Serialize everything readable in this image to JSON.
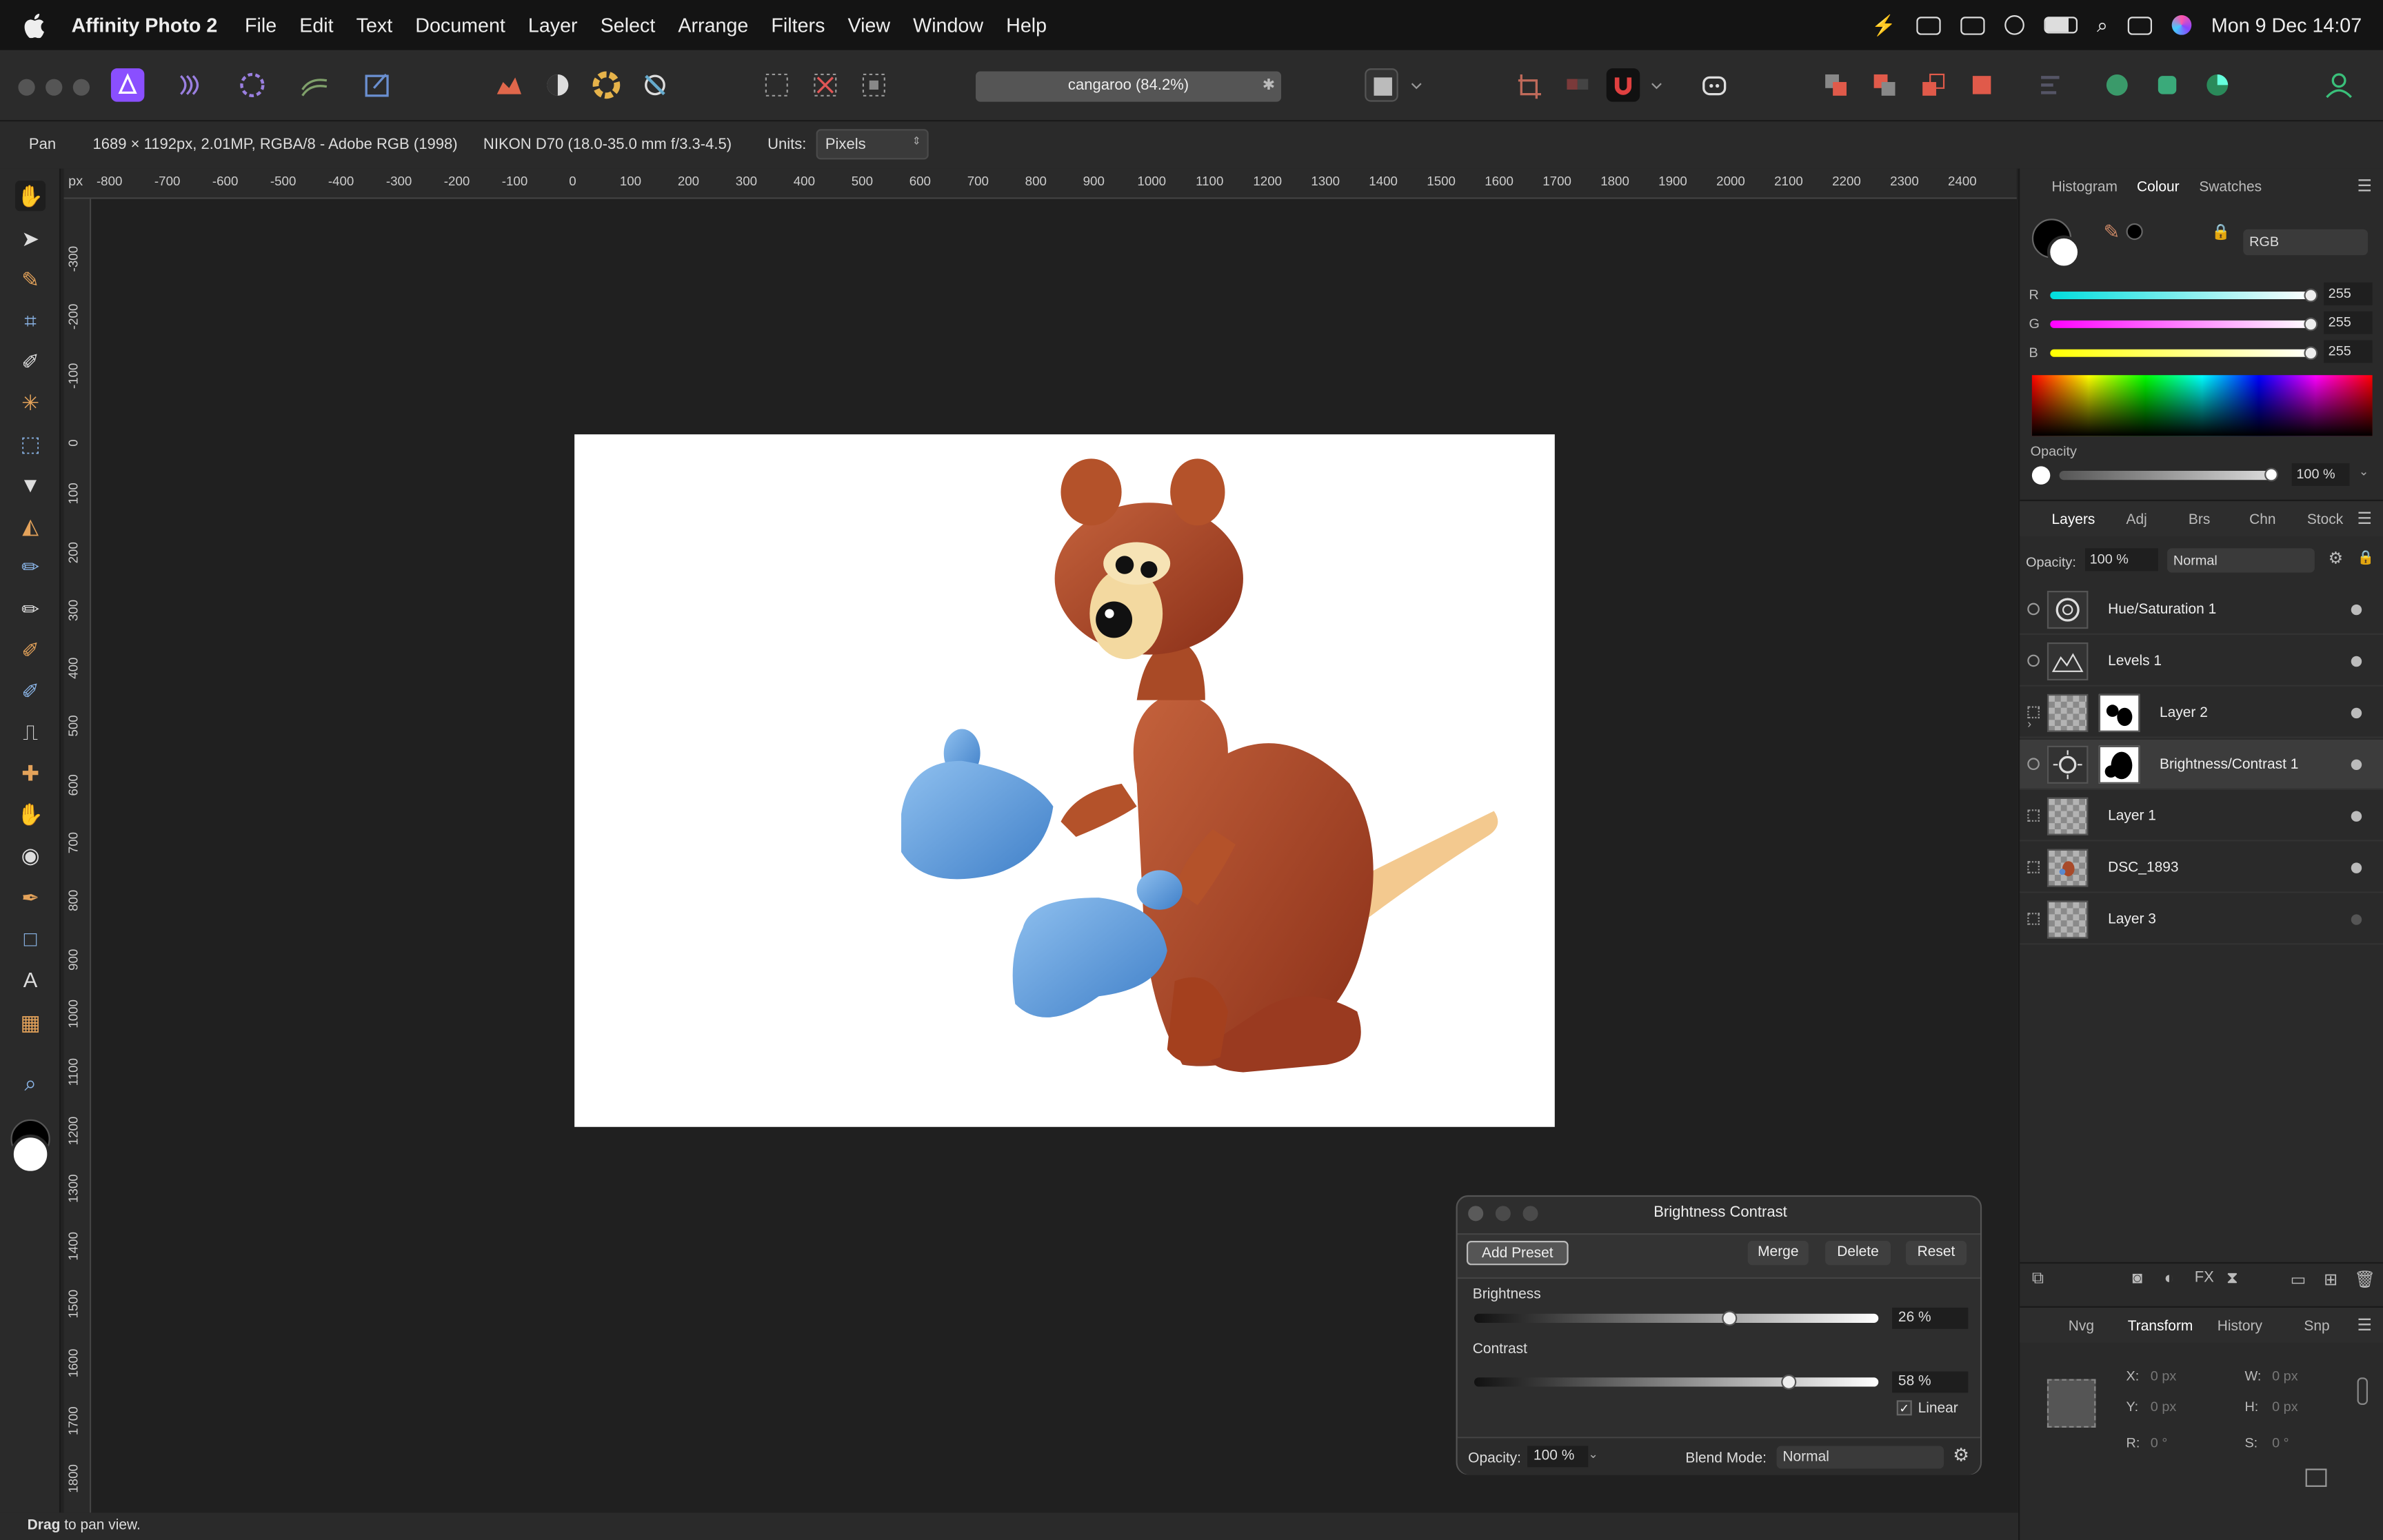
{
  "menubar": {
    "app": "Affinity Photo 2",
    "items": [
      "File",
      "Edit",
      "Text",
      "Document",
      "Layer",
      "Select",
      "Arrange",
      "Filters",
      "View",
      "Window",
      "Help"
    ],
    "clock": "Mon 9 Dec  14:07"
  },
  "toolbar": {
    "document_title": "cangaroo (84.2%)"
  },
  "context": {
    "tool": "Pan",
    "doc_info": "1689 × 1192px, 2.01MP, RGBA/8 - Adobe RGB (1998)",
    "camera": "NIKON D70 (18.0-35.0 mm f/3.3-4.5)",
    "units_label": "Units:",
    "units_value": "Pixels"
  },
  "ruler": {
    "unit": "px",
    "h_ticks": [
      "-800",
      "-700",
      "-600",
      "-500",
      "-400",
      "-300",
      "-200",
      "-100",
      "0",
      "100",
      "200",
      "300",
      "400",
      "500",
      "600",
      "700",
      "800",
      "900",
      "1000",
      "1100",
      "1200",
      "1300",
      "1400",
      "1500",
      "1600",
      "1700",
      "1800",
      "1900",
      "2000",
      "2100",
      "2200",
      "2300",
      "2400"
    ],
    "v_ticks": [
      "-300",
      "-200",
      "-100",
      "0",
      "100",
      "200",
      "300",
      "400",
      "500",
      "600",
      "700",
      "800",
      "900",
      "1000",
      "1100",
      "1200",
      "1300",
      "1400",
      "1500",
      "1600",
      "1700",
      "1800"
    ]
  },
  "colour_panel": {
    "tabs": [
      "Histogram",
      "Colour",
      "Swatches"
    ],
    "active_tab": "Colour",
    "model": "RGB",
    "r_label": "R",
    "g_label": "G",
    "b_label": "B",
    "r": "255",
    "g": "255",
    "b": "255",
    "opacity_label": "Opacity",
    "opacity": "100 %"
  },
  "layers_panel": {
    "tabs": [
      "Layers",
      "Adj",
      "Brs",
      "Chn",
      "Stock"
    ],
    "active_tab": "Layers",
    "opacity_label": "Opacity:",
    "opacity": "100 %",
    "blend": "Normal",
    "layers": [
      {
        "name": "Hue/Saturation 1"
      },
      {
        "name": "Levels 1"
      },
      {
        "name": "Layer 2"
      },
      {
        "name": "Brightness/Contrast 1"
      },
      {
        "name": "Layer 1"
      },
      {
        "name": "DSC_1893"
      },
      {
        "name": "Layer 3"
      }
    ]
  },
  "transform_panel": {
    "tabs": [
      "Nvg",
      "Transform",
      "History",
      "Snp"
    ],
    "active_tab": "Transform",
    "x_label": "X:",
    "x": "0 px",
    "y_label": "Y:",
    "y": "0 px",
    "w_label": "W:",
    "w": "0 px",
    "h_label": "H:",
    "h": "0 px",
    "r_label": "R:",
    "r": "0 °",
    "s_label": "S:",
    "s": "0 °"
  },
  "dialog": {
    "title": "Brightness Contrast",
    "add_preset": "Add Preset",
    "merge": "Merge",
    "delete": "Delete",
    "reset": "Reset",
    "brightness_label": "Brightness",
    "brightness_value": "26 %",
    "brightness_level": 0.63,
    "contrast_label": "Contrast",
    "contrast_value": "58 %",
    "contrast_level": 0.78,
    "linear_label": "Linear",
    "linear_checked": true,
    "opacity_label": "Opacity:",
    "opacity_value": "100 %",
    "blend_label": "Blend Mode:",
    "blend_value": "Normal"
  },
  "status": {
    "bold": "Drag",
    "text": " to pan view."
  },
  "colors": {
    "accent": "#8a4fff",
    "fill_black": "#000000",
    "fill_white": "#ffffff"
  }
}
